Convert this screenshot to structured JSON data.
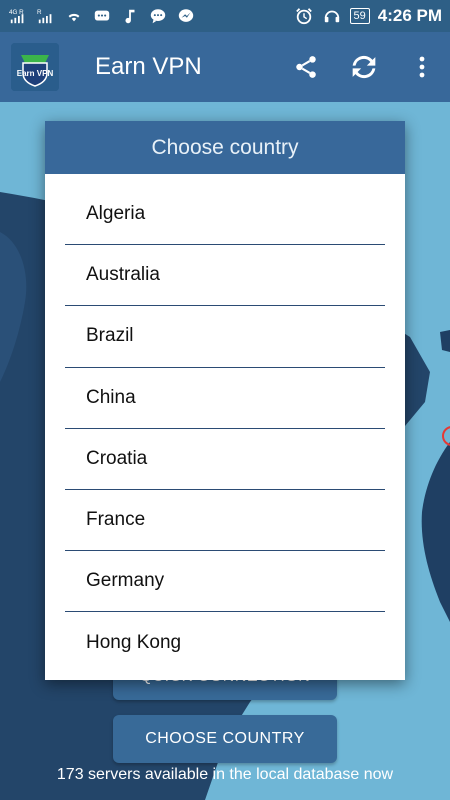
{
  "status_bar": {
    "network_label": "4G R",
    "network_label_2": "R",
    "battery": "59",
    "time": "4:26 PM",
    "icons": [
      "signal-icon",
      "signal-icon",
      "wifi-icon",
      "message-icon",
      "music-icon",
      "chat-icon",
      "messenger-icon",
      "alarm-icon",
      "headset-icon",
      "battery-icon"
    ]
  },
  "app_bar": {
    "title": "Earn VPN",
    "logo_text": "Earn VPN",
    "actions": [
      "share-icon",
      "refresh-icon",
      "more-icon"
    ]
  },
  "dialog": {
    "title": "Choose country",
    "countries": [
      "Algeria",
      "Australia",
      "Brazil",
      "China",
      "Croatia",
      "France",
      "Germany",
      "Hong Kong"
    ]
  },
  "buttons": {
    "quick_connection": "QUICK CONNECTION",
    "choose_country": "CHOOSE COUNTRY"
  },
  "footer": {
    "servers_note": "173 servers available in the local database now"
  },
  "colors": {
    "primary": "#38689a",
    "status_bar": "#2e5f86",
    "map_water": "#6fb6d6",
    "map_land": "#1f3f63"
  }
}
